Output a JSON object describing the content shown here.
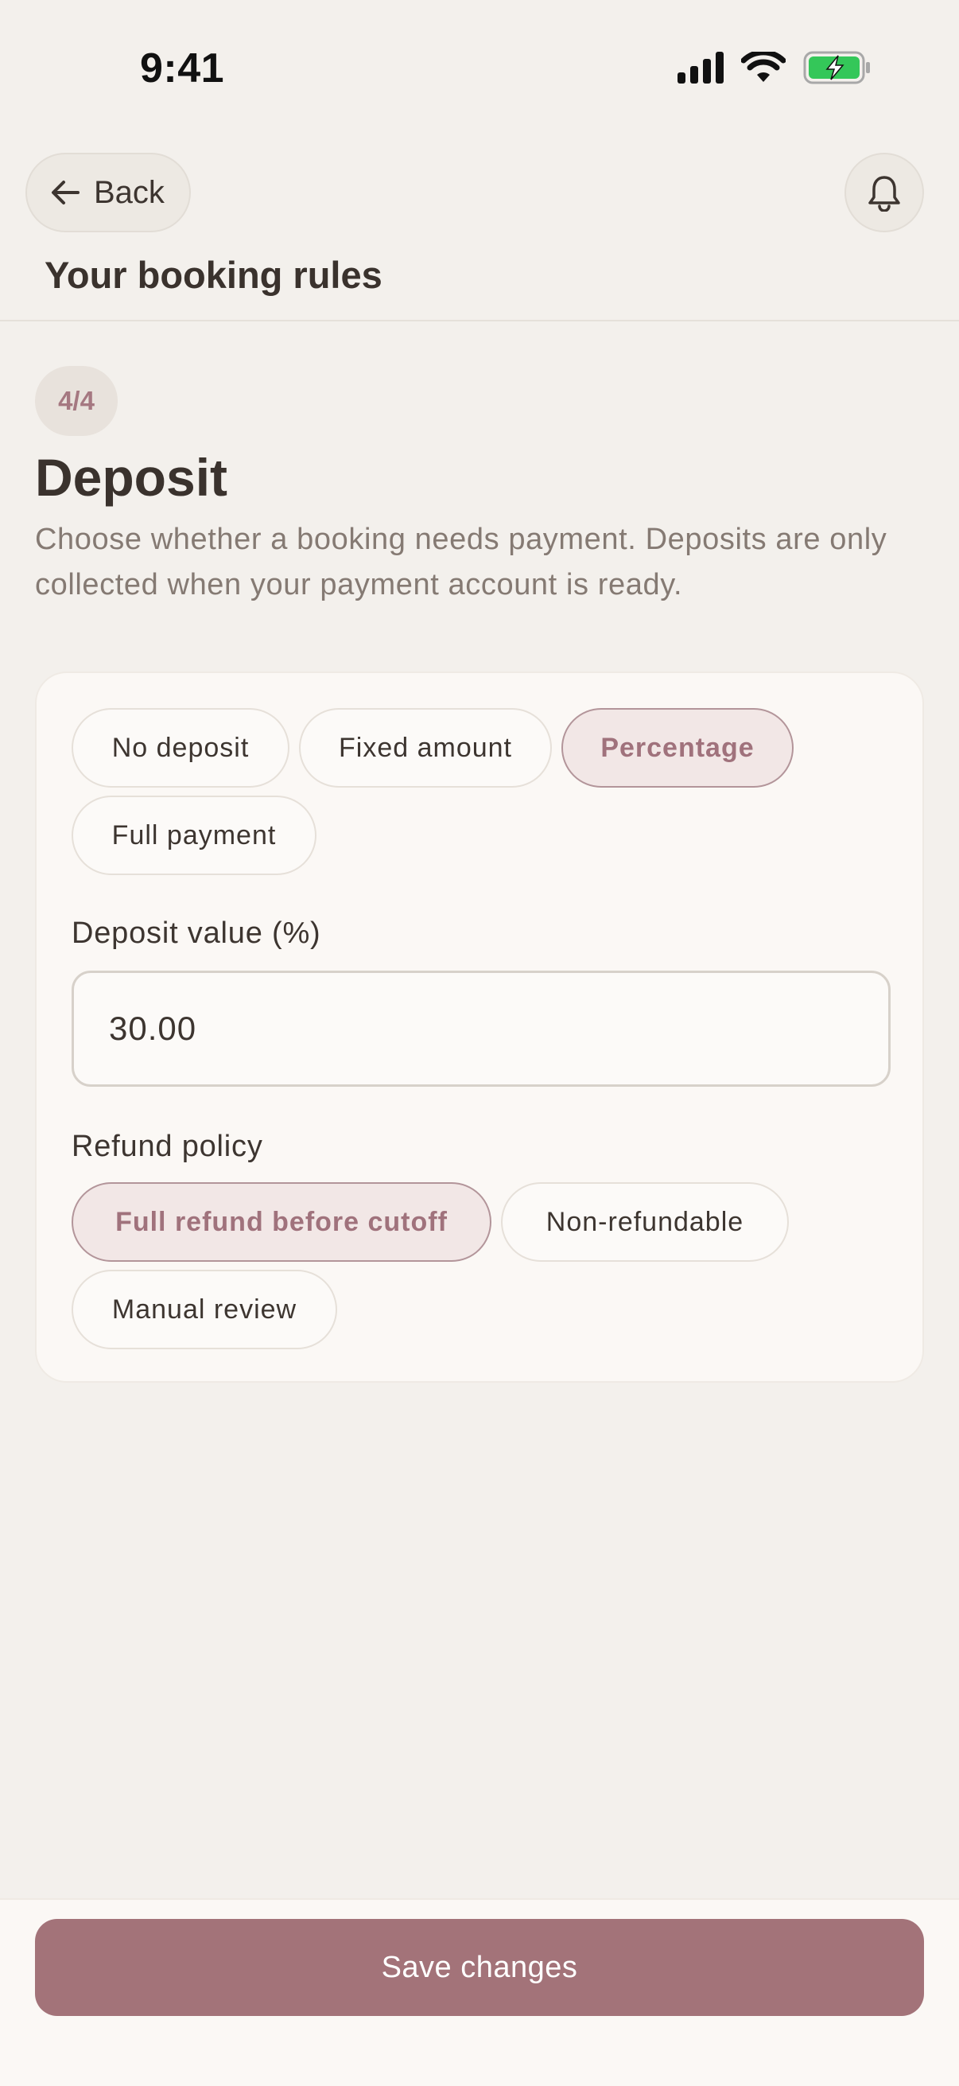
{
  "status_bar": {
    "time": "9:41",
    "battery_color": "#34c759"
  },
  "header": {
    "back_label": "Back",
    "title": "Your booking rules"
  },
  "step": {
    "badge": "4/4",
    "title": "Deposit",
    "description": "Choose whether a booking needs payment. Deposits are only collected when your payment account is ready."
  },
  "deposit_type": {
    "options": [
      "No deposit",
      "Fixed amount",
      "Percentage",
      "Full payment"
    ],
    "selected": "Percentage"
  },
  "deposit_value": {
    "label": "Deposit value (%)",
    "value": "30.00"
  },
  "refund_policy": {
    "label": "Refund policy",
    "options": [
      "Full refund before cutoff",
      "Non-refundable",
      "Manual review"
    ],
    "selected": "Full refund before cutoff"
  },
  "footer": {
    "save_label": "Save changes"
  },
  "colors": {
    "accent": "#a37379",
    "accent_soft": "#f2e7e6",
    "background": "#f3f0ec"
  }
}
